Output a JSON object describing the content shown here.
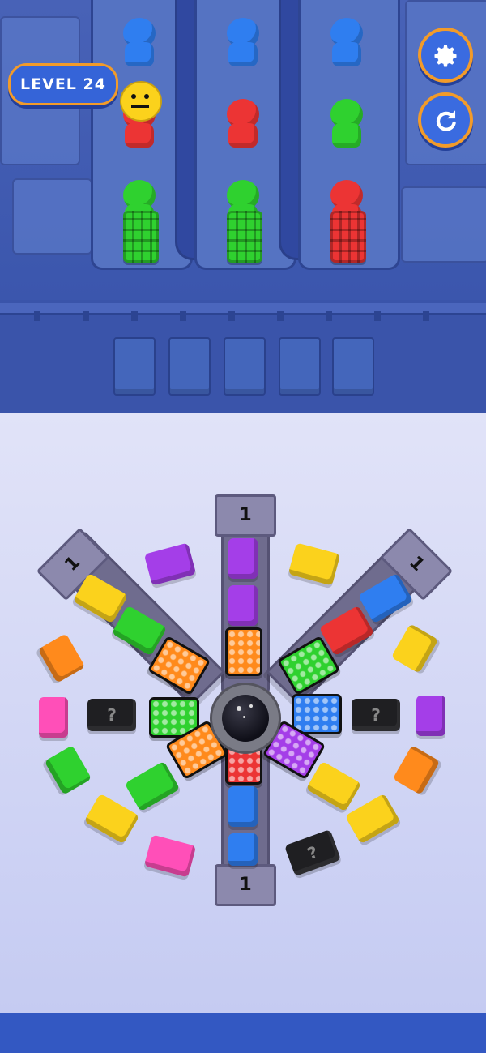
{
  "level": {
    "label": "LEVEL 24"
  },
  "buttons": {
    "settings_icon": "gear-icon",
    "restart_icon": "restart-icon"
  },
  "queue": {
    "lanes": [
      {
        "people": [
          "blue",
          "red",
          "green"
        ],
        "cart": "green",
        "front_face": "yellow"
      },
      {
        "people": [
          "blue",
          "red",
          "green"
        ],
        "cart": "green"
      },
      {
        "people": [
          "blue",
          "green",
          "red"
        ],
        "cart": "red"
      }
    ]
  },
  "belt_slots": 5,
  "spinner": {
    "arm_counts": {
      "top": "1",
      "left": "1",
      "right": "1",
      "bottom": "1"
    },
    "mystery_symbol": "?"
  },
  "colors": {
    "blue": "#2f7ef0",
    "red": "#ec3434",
    "green": "#2fd12f",
    "yellow": "#fbd21c",
    "orange": "#ff8a1c",
    "purple": "#a43ee8",
    "pink": "#ff4fb8",
    "black": "#1f1f22",
    "accent": "#f29b2a"
  }
}
